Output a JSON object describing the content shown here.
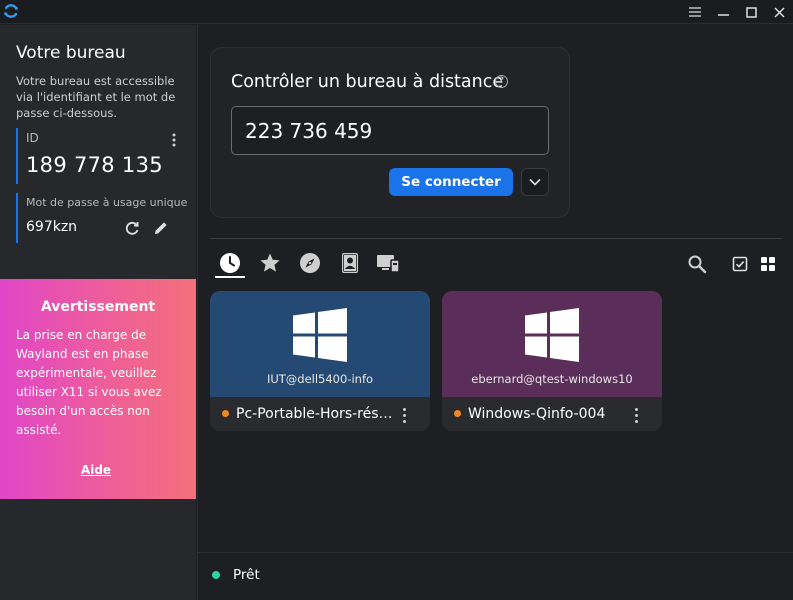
{
  "colors": {
    "accent": "#1a73e8",
    "card_blue": "#244a74",
    "card_purple": "#5a2e58",
    "warning_gradient": [
      "#e046c8",
      "#f3707a"
    ],
    "status_ready": "#2dd4a7",
    "peer_offline": "#f08a2c"
  },
  "titlebar": {
    "icons": [
      "rustdesk-logo-icon",
      "hamburger-menu-icon",
      "minimize-icon",
      "maximize-icon",
      "close-icon"
    ]
  },
  "left_panel": {
    "title": "Votre bureau",
    "description": "Votre bureau est accessible via l'identifiant et le mot de passe ci-dessous.",
    "id_label": "ID",
    "id_value": "189 778 135",
    "password_label": "Mot de passe à usage unique",
    "password_value": "697kzn",
    "warning": {
      "title": "Avertissement",
      "text": "La prise en charge de Wayland est en phase expérimentale, veuillez utiliser X11 si vous avez besoin d'un accès non assisté.",
      "link": "Aide"
    }
  },
  "connect": {
    "title": "Contrôler un bureau à distance",
    "help_glyph": "?",
    "input_value": "223 736 459",
    "button": "Se connecter"
  },
  "tabs": [
    {
      "icon": "clock-icon",
      "name": "recent",
      "active": true
    },
    {
      "icon": "star-icon",
      "name": "favorites",
      "active": false
    },
    {
      "icon": "compass-icon",
      "name": "discovered",
      "active": false
    },
    {
      "icon": "address-book-icon",
      "name": "address-book",
      "active": false
    },
    {
      "icon": "devices-icon",
      "name": "group",
      "active": false
    }
  ],
  "peers": [
    {
      "user": "IUT@dell5400-info",
      "name": "Pc-Portable-Hors-réseau",
      "os_icon": "windows-logo-icon",
      "online": false
    },
    {
      "user": "ebernard@qtest-windows10",
      "name": "Windows-Qinfo-004",
      "os_icon": "windows-logo-icon",
      "online": false
    }
  ],
  "status": {
    "text": "Prêt"
  }
}
